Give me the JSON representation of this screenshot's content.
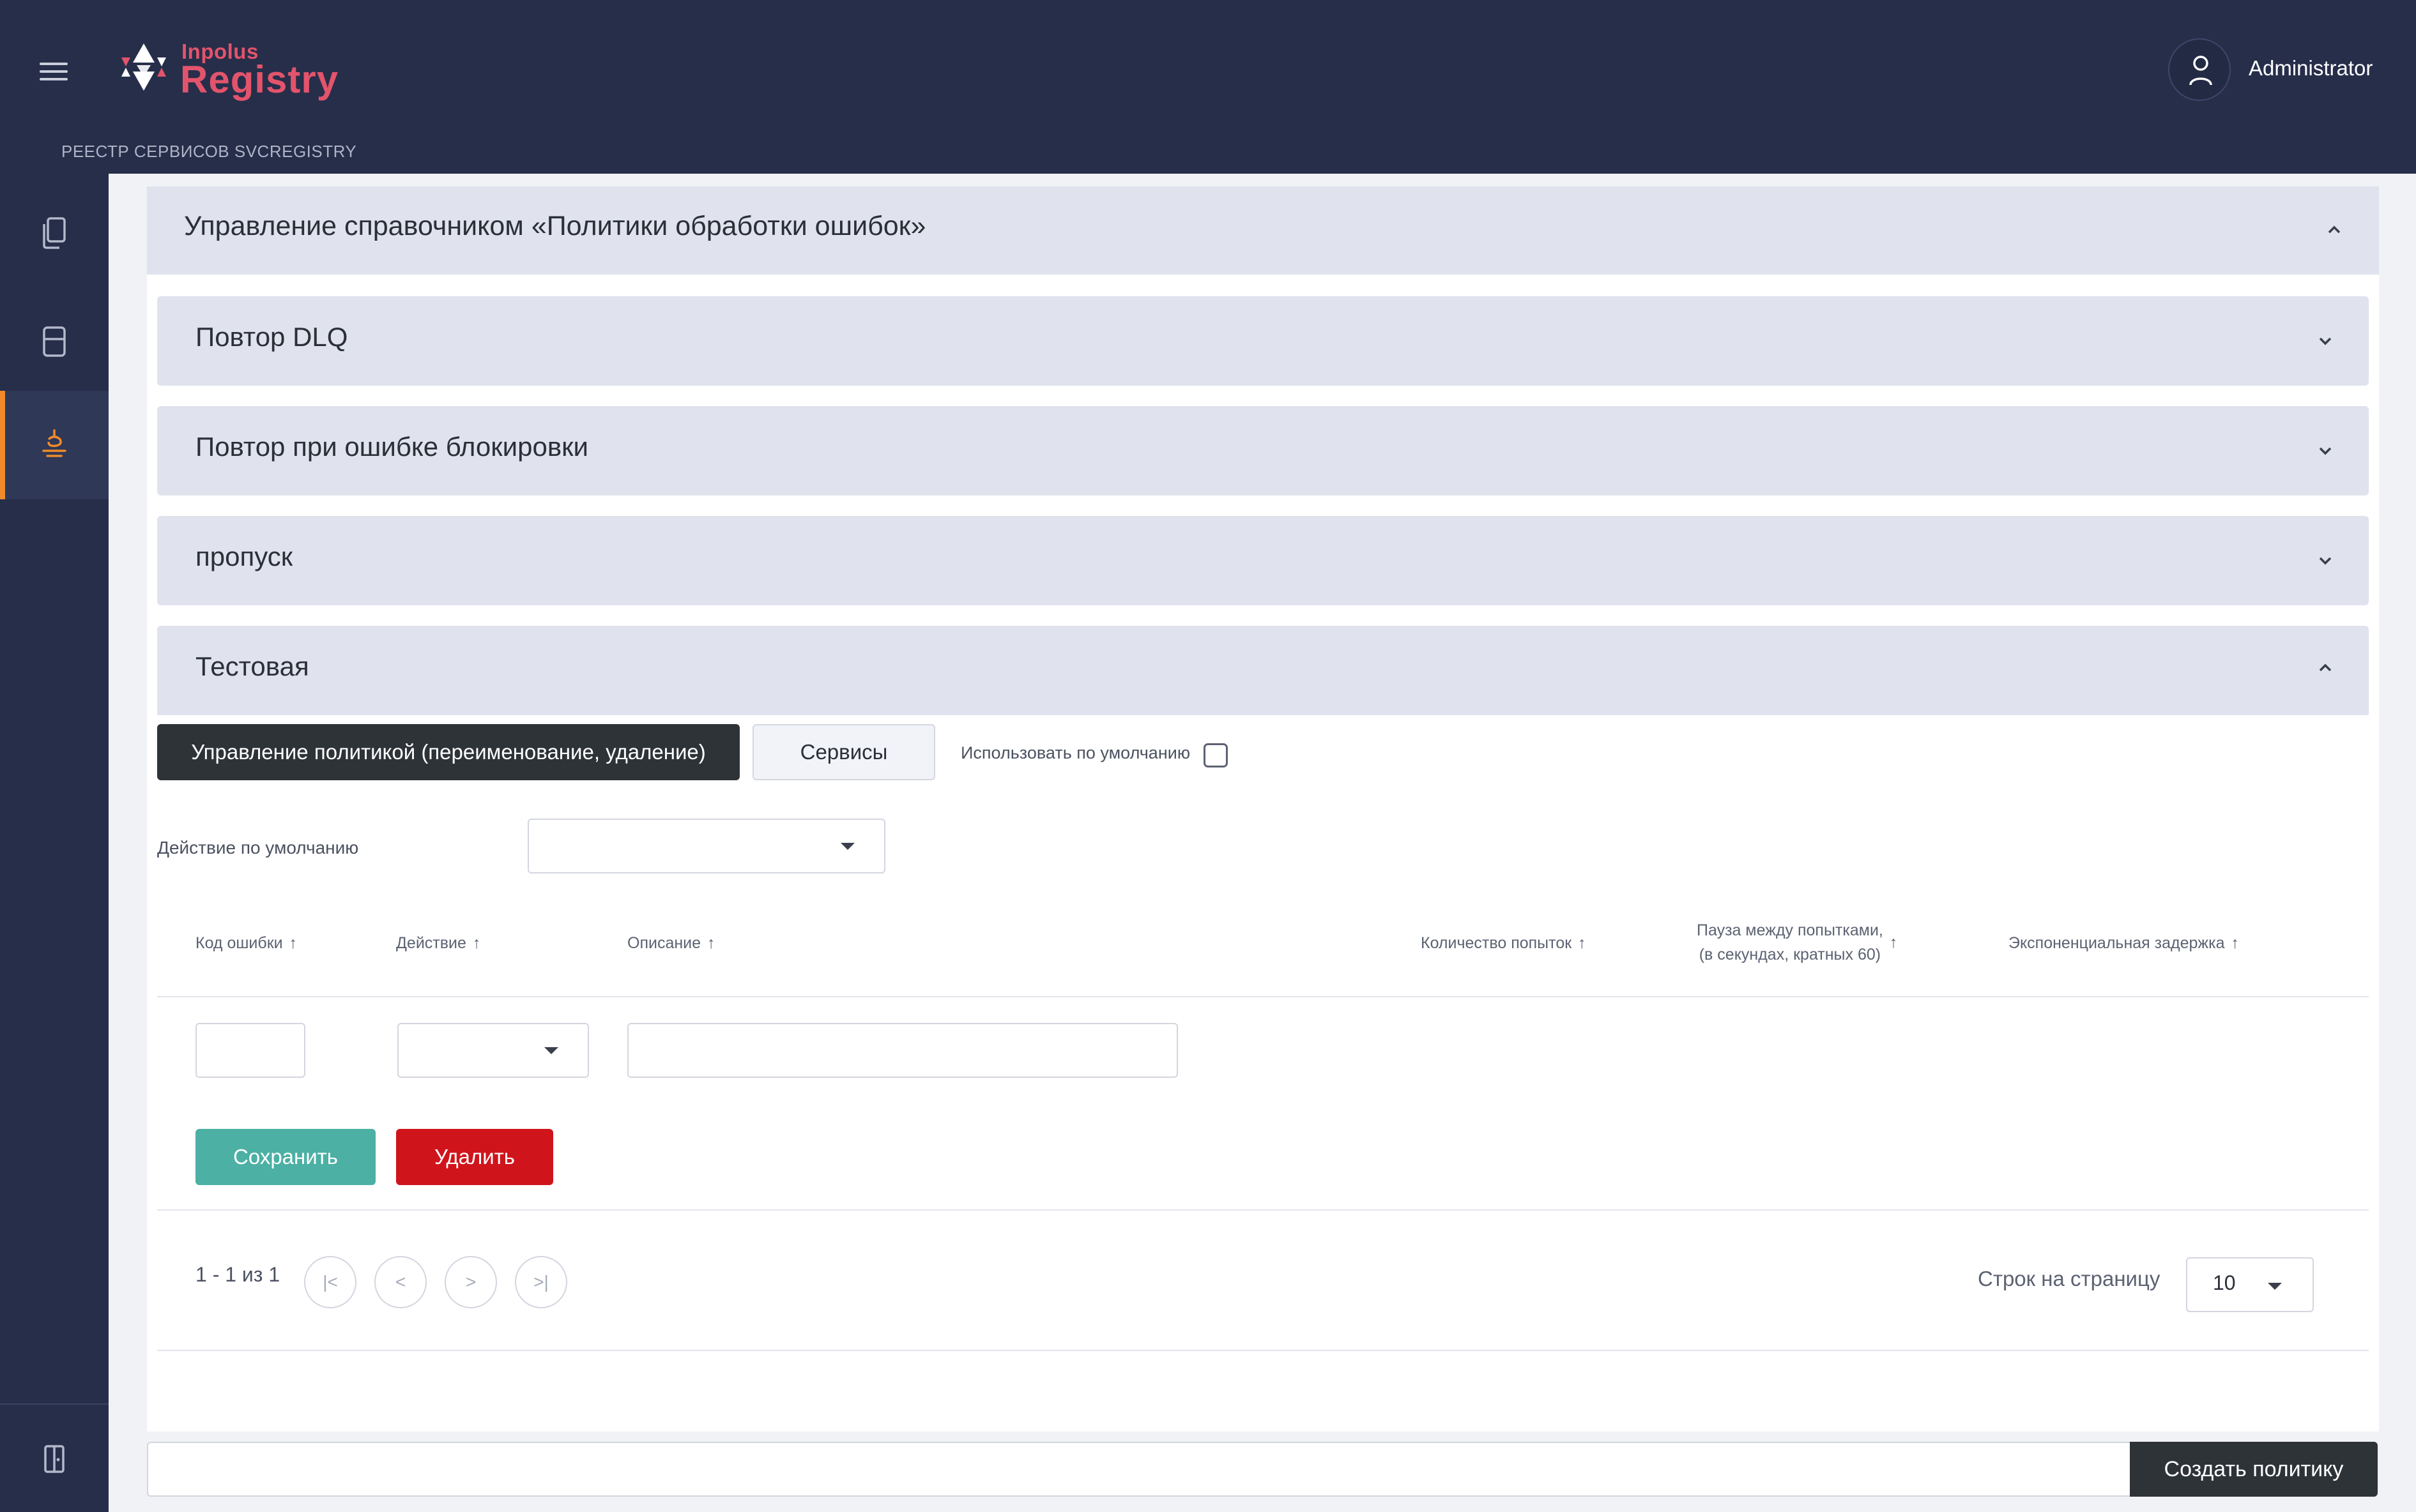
{
  "header": {
    "logo_small": "Inpolus",
    "logo_big": "Registry",
    "breadcrumb": "РЕЕСТР СЕРВИСОВ SVCREGISTRY",
    "user_name": "Administrator"
  },
  "sidebar": {
    "items": [
      {
        "icon": "documents-icon",
        "active": false
      },
      {
        "icon": "storage-icon",
        "active": false
      },
      {
        "icon": "policy-icon",
        "active": true
      }
    ],
    "bottom_icon": "exit-door-icon"
  },
  "main": {
    "outer_title": "Управление справочником «Политики обработки ошибок»",
    "policies": [
      {
        "title": "Повтор DLQ",
        "expanded": false
      },
      {
        "title": "Повтор при ошибке блокировки",
        "expanded": false
      },
      {
        "title": "пропуск",
        "expanded": false
      },
      {
        "title": "Тестовая",
        "expanded": true
      }
    ],
    "manage_button": "Управление политикой (переименование, удаление)",
    "services_button": "Сервисы",
    "use_default_label": "Использовать по умолчанию",
    "use_default_checked": false,
    "default_action_label": "Действие по умолчанию",
    "default_action_value": "",
    "table": {
      "headers": {
        "code": "Код ошибки",
        "action": "Действие",
        "description": "Описание",
        "attempts": "Количество попыток",
        "pause_line1": "Пауза между попытками,",
        "pause_line2": "(в секундах, кратных 60)",
        "exponential": "Экспоненциальная задержка"
      },
      "sort_arrow": "↑",
      "row": {
        "code": "",
        "action": "",
        "description": ""
      }
    },
    "save_button": "Сохранить",
    "delete_button": "Удалить",
    "pagination": {
      "range": "1 - 1 из 1",
      "first": "|<",
      "prev": "<",
      "next": ">",
      "last": ">|",
      "rows_label": "Строк на страницу",
      "rows_value": "10"
    }
  },
  "footer": {
    "new_policy_value": "",
    "create_button": "Создать политику"
  },
  "colors": {
    "header_bg": "#262e4a",
    "accent": "#f08a2a",
    "logo": "#e2546b",
    "save": "#4cb0a4",
    "delete": "#d0141c",
    "dark_button": "#2e3338",
    "accordion_bg": "#e0e2ed"
  }
}
